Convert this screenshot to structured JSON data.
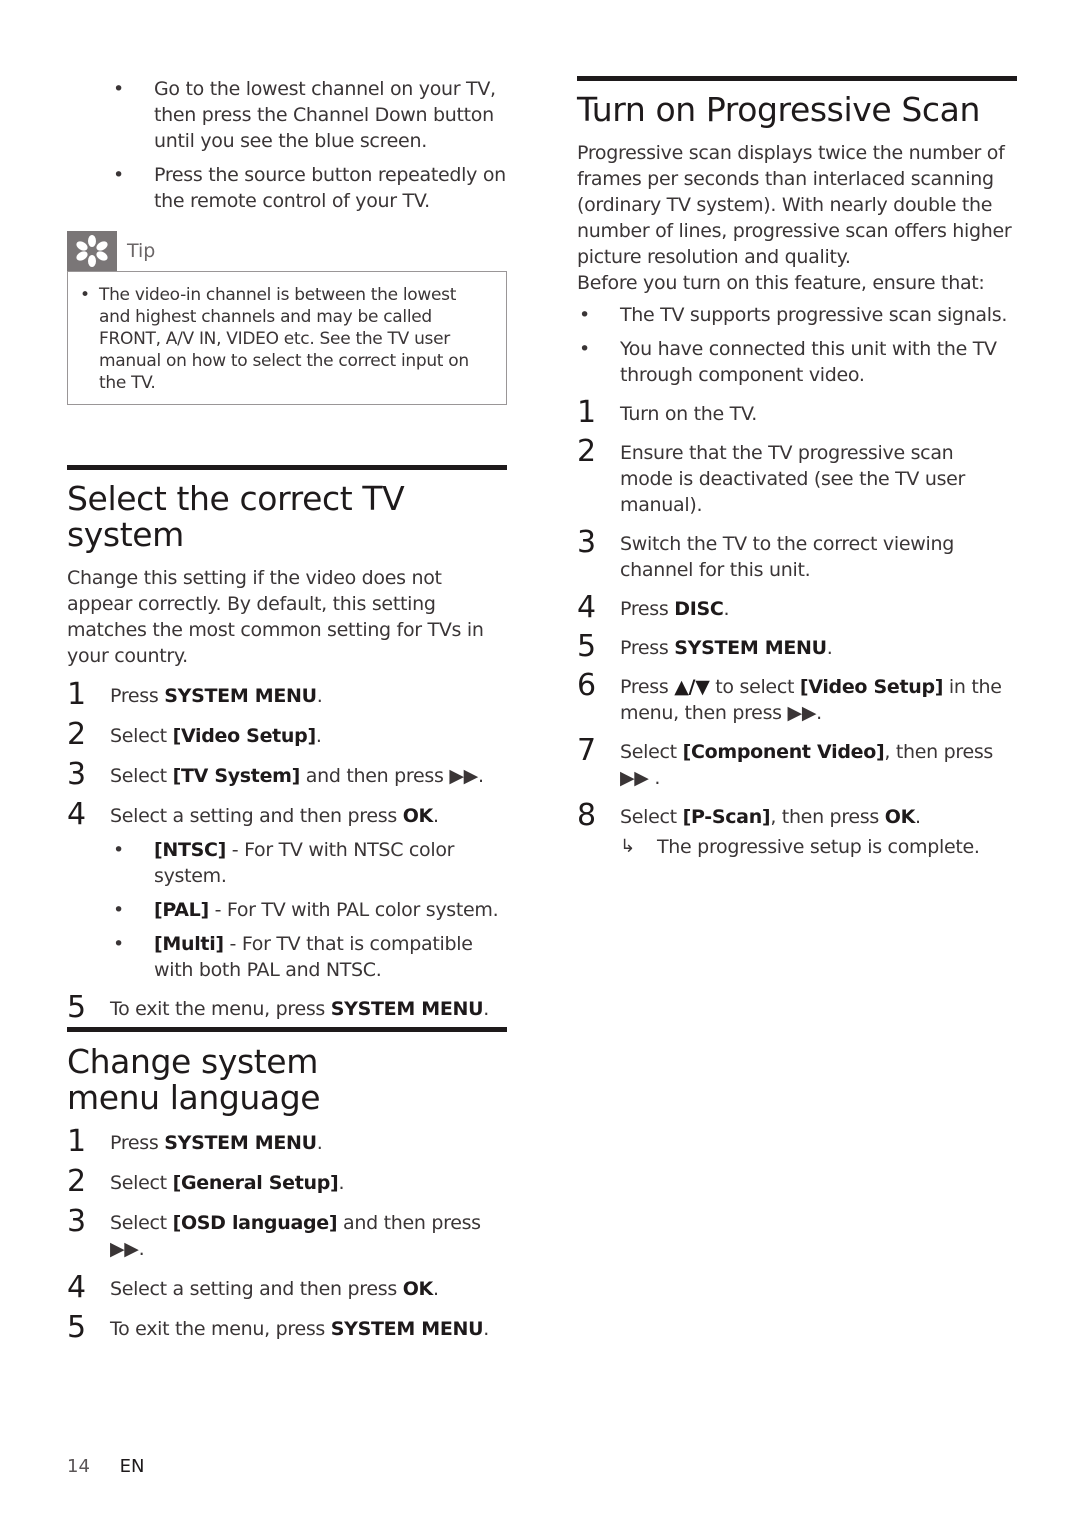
{
  "left": {
    "intro_bullets": [
      "Go to the lowest channel on your TV, then press the Channel Down button until you see the blue screen.",
      "Press the source button repeatedly on the remote control of your TV."
    ],
    "tip": {
      "icon": "asterisk-icon",
      "label": "Tip",
      "items": [
        "The video-in channel is between the lowest and highest channels and may be called FRONT, A/V IN, VIDEO etc. See the TV user manual on how to select the correct input on the TV."
      ]
    },
    "tv_system": {
      "title": "Select the correct TV system",
      "intro": "Change this setting if the video does not appear correctly. By default, this setting matches the most common setting for TVs in your country.",
      "steps": [
        {
          "num": "1",
          "pre": "Press ",
          "bold": "SYSTEM MENU",
          "post": "."
        },
        {
          "num": "2",
          "pre": "Select ",
          "bold": "[Video Setup]",
          "post": "."
        },
        {
          "num": "3",
          "pre": "Select ",
          "bold": "[TV System]",
          "post": " and then press ▶▶."
        },
        {
          "num": "4",
          "pre": "Select a setting and then press ",
          "bold": "OK",
          "post": "."
        }
      ],
      "options": [
        {
          "bold": "[NTSC]",
          "text": " - For TV with NTSC color system."
        },
        {
          "bold": "[PAL]",
          "text": " - For TV with PAL color system."
        },
        {
          "bold": "[Multi]",
          "text": " - For TV that is compatible with both PAL and NTSC."
        }
      ],
      "final_step": {
        "num": "5",
        "pre": "To exit the menu, press ",
        "bold": "SYSTEM MENU",
        "post": "."
      }
    },
    "menu_language": {
      "title": "Change system menu language",
      "steps": [
        {
          "num": "1",
          "pre": "Press ",
          "bold": "SYSTEM MENU",
          "post": "."
        },
        {
          "num": "2",
          "pre": "Select ",
          "bold": "[General Setup]",
          "post": "."
        },
        {
          "num": "3",
          "pre": "Select ",
          "bold": "[OSD language]",
          "post": " and then press ▶▶."
        },
        {
          "num": "4",
          "pre": "Select a setting and then press ",
          "bold": "OK",
          "post": "."
        },
        {
          "num": "5",
          "pre": "To exit the menu, press ",
          "bold": "SYSTEM MENU",
          "post": "."
        }
      ]
    }
  },
  "right": {
    "progressive": {
      "title": "Turn on Progressive Scan",
      "intro": "Progressive scan displays twice the number of frames per seconds than interlaced scanning (ordinary TV system). With nearly double the number of lines, progressive scan offers higher picture resolution and quality.",
      "before": "Before you turn on this feature, ensure that:",
      "prereqs": [
        "The TV supports progressive scan signals.",
        "You have connected this unit with the TV through component video."
      ],
      "steps": [
        {
          "num": "1",
          "pre": "Turn on the TV.",
          "bold": "",
          "post": ""
        },
        {
          "num": "2",
          "pre": "Ensure that the TV progressive scan mode is deactivated (see the TV user manual).",
          "bold": "",
          "post": ""
        },
        {
          "num": "3",
          "pre": "Switch the TV to the correct viewing channel for this unit.",
          "bold": "",
          "post": ""
        },
        {
          "num": "4",
          "pre": "Press ",
          "bold": "DISC",
          "post": "."
        },
        {
          "num": "5",
          "pre": "Press ",
          "bold": "SYSTEM MENU",
          "post": "."
        },
        {
          "num": "6",
          "pre": "Press ",
          "bold": "▲/▼",
          "mid": " to select ",
          "bold2": "[Video Setup]",
          "post": " in the menu, then press ▶▶."
        },
        {
          "num": "7",
          "pre": "Select ",
          "bold": "[Component Video]",
          "post": ", then press ▶▶ ."
        },
        {
          "num": "8",
          "pre": "Select ",
          "bold": "[P-Scan]",
          "post": ", then press ",
          "bold2": "OK",
          "post2": "."
        }
      ],
      "result_arrow": "↳",
      "result": "The progressive setup is complete."
    }
  },
  "footer": {
    "page_number": "14",
    "language": "EN"
  }
}
